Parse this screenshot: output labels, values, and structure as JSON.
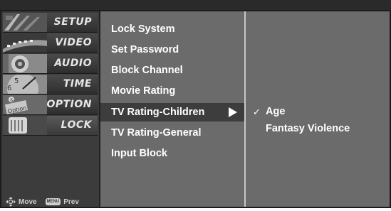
{
  "categories": [
    {
      "label": "SETUP",
      "icon": "setup-thumbnail-icon"
    },
    {
      "label": "VIDEO",
      "icon": "video-thumbnail-icon"
    },
    {
      "label": "AUDIO",
      "icon": "audio-thumbnail-icon"
    },
    {
      "label": "TIME",
      "icon": "time-thumbnail-icon"
    },
    {
      "label": "OPTION",
      "icon": "option-thumbnail-icon"
    },
    {
      "label": "LOCK",
      "icon": "lock-thumbnail-icon"
    }
  ],
  "hints": {
    "move_label": "Move",
    "menu_key": "MENU",
    "prev_label": "Prev"
  },
  "menu": {
    "items": [
      {
        "label": "Lock System"
      },
      {
        "label": "Set Password"
      },
      {
        "label": "Block Channel"
      },
      {
        "label": "Movie Rating"
      },
      {
        "label": "TV Rating-Children",
        "selected": true,
        "has_submenu": true
      },
      {
        "label": "TV Rating-General"
      },
      {
        "label": "Input Block"
      }
    ]
  },
  "submenu": {
    "items": [
      {
        "label": "Age",
        "checked": true
      },
      {
        "label": "Fantasy Violence",
        "checked": false
      }
    ]
  },
  "colors": {
    "panel_bg": "#6b6b6b",
    "selected_bg": "#3d3d3d",
    "text": "#ffffff"
  }
}
